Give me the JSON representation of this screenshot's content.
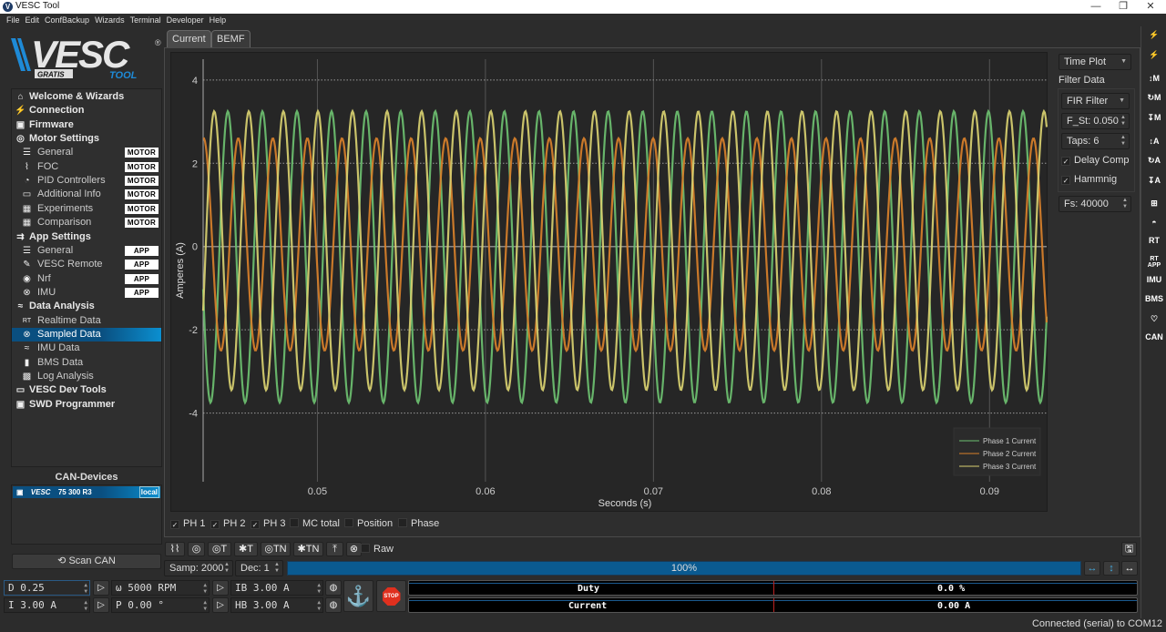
{
  "window": {
    "title": "VESC Tool",
    "minimize": "—",
    "maximize": "❐",
    "close": "✕"
  },
  "menu": [
    "File",
    "Edit",
    "ConfBackup",
    "Wizards",
    "Terminal",
    "Developer",
    "Help"
  ],
  "logo": {
    "text": "VESC",
    "sub1": "GRATIS",
    "sub2": "TOOL"
  },
  "sidebar": {
    "items": [
      {
        "label": "Welcome & Wizards",
        "icon": "home-icon",
        "glyph": "⌂",
        "level": 0
      },
      {
        "label": "Connection",
        "icon": "plug-icon",
        "glyph": "⚡",
        "level": 0
      },
      {
        "label": "Firmware",
        "icon": "chip-icon",
        "glyph": "▣",
        "level": 0
      },
      {
        "label": "Motor Settings",
        "icon": "motor-icon",
        "glyph": "◎",
        "level": 0
      },
      {
        "label": "General",
        "icon": "sliders-icon",
        "glyph": "☰",
        "level": 1,
        "badge": "MOTOR"
      },
      {
        "label": "FOC",
        "icon": "coil-icon",
        "glyph": "⌇",
        "level": 1,
        "badge": "MOTOR"
      },
      {
        "label": "PID Controllers",
        "icon": "gauge-icon",
        "glyph": "◔",
        "level": 1,
        "badge": "MOTOR"
      },
      {
        "label": "Additional Info",
        "icon": "info-icon",
        "glyph": "▭",
        "level": 1,
        "badge": "MOTOR"
      },
      {
        "label": "Experiments",
        "icon": "calculator-icon",
        "glyph": "▦",
        "level": 1,
        "badge": "MOTOR"
      },
      {
        "label": "Comparison",
        "icon": "calculator-icon",
        "glyph": "▦",
        "level": 1,
        "badge": "MOTOR"
      },
      {
        "label": "App Settings",
        "icon": "app-icon",
        "glyph": "⇉",
        "level": 0
      },
      {
        "label": "General",
        "icon": "sliders-icon",
        "glyph": "☰",
        "level": 1,
        "badge": "APP"
      },
      {
        "label": "VESC Remote",
        "icon": "remote-icon",
        "glyph": "✎",
        "level": 1,
        "badge": "APP"
      },
      {
        "label": "Nrf",
        "icon": "wireless-icon",
        "glyph": "◉",
        "level": 1,
        "badge": "APP"
      },
      {
        "label": "IMU",
        "icon": "imu-icon",
        "glyph": "⊗",
        "level": 1,
        "badge": "APP"
      },
      {
        "label": "Data Analysis",
        "icon": "graph-icon",
        "glyph": "≈",
        "level": 0
      },
      {
        "label": "Realtime Data",
        "icon": "rt-icon",
        "glyph": "RT",
        "level": 1
      },
      {
        "label": "Sampled Data",
        "icon": "sampled-icon",
        "glyph": "⊗",
        "level": 1,
        "selected": true
      },
      {
        "label": "IMU Data",
        "icon": "graph-icon",
        "glyph": "≈",
        "level": 1
      },
      {
        "label": "BMS Data",
        "icon": "battery-icon",
        "glyph": "▮",
        "level": 1
      },
      {
        "label": "Log Analysis",
        "icon": "map-icon",
        "glyph": "▩",
        "level": 1
      },
      {
        "label": "VESC Dev Tools",
        "icon": "terminal-icon",
        "glyph": "▭",
        "level": 0
      },
      {
        "label": "SWD Programmer",
        "icon": "chip-icon",
        "glyph": "▣",
        "level": 0
      }
    ]
  },
  "can": {
    "title": "CAN-Devices",
    "device": "75 300 R3",
    "device_brand": "VESC",
    "device_tag": "local",
    "scan_label": "⟲ Scan CAN"
  },
  "tabs": [
    {
      "label": "Current",
      "active": true
    },
    {
      "label": "BEMF"
    }
  ],
  "plot_settings": {
    "mode": "Time Plot",
    "filter_title": "Filter Data",
    "filter": "FIR Filter",
    "f_st": "F_St: 0.050",
    "taps": "Taps: 6",
    "delay_comp": "Delay Comp",
    "delay_comp_checked": true,
    "hamming": "Hammnig",
    "hamming_checked": true,
    "fs": "Fs: 40000"
  },
  "chart_data": {
    "type": "line",
    "xlabel": "Seconds (s)",
    "ylabel": "Amperes (A)",
    "xlim": [
      0.0432,
      0.0934
    ],
    "ylim": [
      -5.65,
      4.5
    ],
    "xticks": [
      "0.05",
      "0.06",
      "0.07",
      "0.08",
      "0.09"
    ],
    "yticks": [
      "4",
      "2",
      "0",
      "-2",
      "-4"
    ],
    "grid": true,
    "legend_position": "bottom-right",
    "series": [
      {
        "name": "Phase 1 Current",
        "color": "#6cc070",
        "amplitude": 3.5,
        "offset": -0.25,
        "frequency_hz": 486,
        "peak_time_s": 0.04467
      },
      {
        "name": "Phase 2 Current",
        "color": "#d8802a",
        "amplitude": 2.55,
        "offset": 0.05,
        "frequency_hz": 486,
        "peak_time_s": 0.04529
      },
      {
        "name": "Phase 3 Current",
        "color": "#d8d070",
        "amplitude": 3.35,
        "offset": -0.1,
        "frequency_hz": 486,
        "peak_time_s": 0.04386
      }
    ]
  },
  "channels": [
    {
      "label": "PH 1",
      "checked": true
    },
    {
      "label": "PH 2",
      "checked": true
    },
    {
      "label": "PH 3",
      "checked": true
    },
    {
      "label": "MC total",
      "checked": false
    },
    {
      "label": "Position",
      "checked": false
    },
    {
      "label": "Phase",
      "checked": false
    }
  ],
  "sample_toolbar": {
    "buttons": [
      {
        "icon": "coil-icon",
        "label": "⌇⌇"
      },
      {
        "icon": "motor-icon",
        "label": "◎"
      },
      {
        "icon": "motor-trigger-icon",
        "label": "◎T"
      },
      {
        "icon": "bug-trigger-icon",
        "label": "✱T"
      },
      {
        "icon": "motor-trigger-n-icon",
        "label": "◎TN"
      },
      {
        "icon": "bug-trigger-n-icon",
        "label": "✱TN"
      },
      {
        "icon": "upload-icon",
        "label": "⤒"
      },
      {
        "icon": "stop-circle-icon",
        "label": "⊗"
      }
    ],
    "raw_label": "Raw",
    "raw_checked": false,
    "samp": "Samp: 2000",
    "dec": "Dec: 1",
    "progress_text": "100%",
    "progress": 100
  },
  "controls": {
    "duty": "D 0.25",
    "current": "I 3.00 A",
    "rpm": "ω 5000 RPM",
    "position": "P 0.00 °",
    "ib": "IB 3.00 A",
    "hb": "HB 3.00 A",
    "anchor": "⚓",
    "stop": "STOP"
  },
  "gauges": [
    {
      "label": "Duty",
      "value": "0.0 %",
      "fraction": 0
    },
    {
      "label": "Current",
      "value": "0.00 A",
      "fraction": 0
    }
  ],
  "right_toolbar": [
    "⚡",
    "⚡",
    "↕M",
    "↻M",
    "↧M",
    "↕A",
    "↻A",
    "↧A",
    "⊞",
    "◓",
    "RT",
    "RT APP",
    "IMU",
    "BMS",
    "♡",
    "CAN"
  ],
  "status": "Connected (serial) to COM12",
  "colors": {
    "accent": "#0a5a90",
    "background": "#2c2c2c",
    "plot_bg": "#262626"
  }
}
